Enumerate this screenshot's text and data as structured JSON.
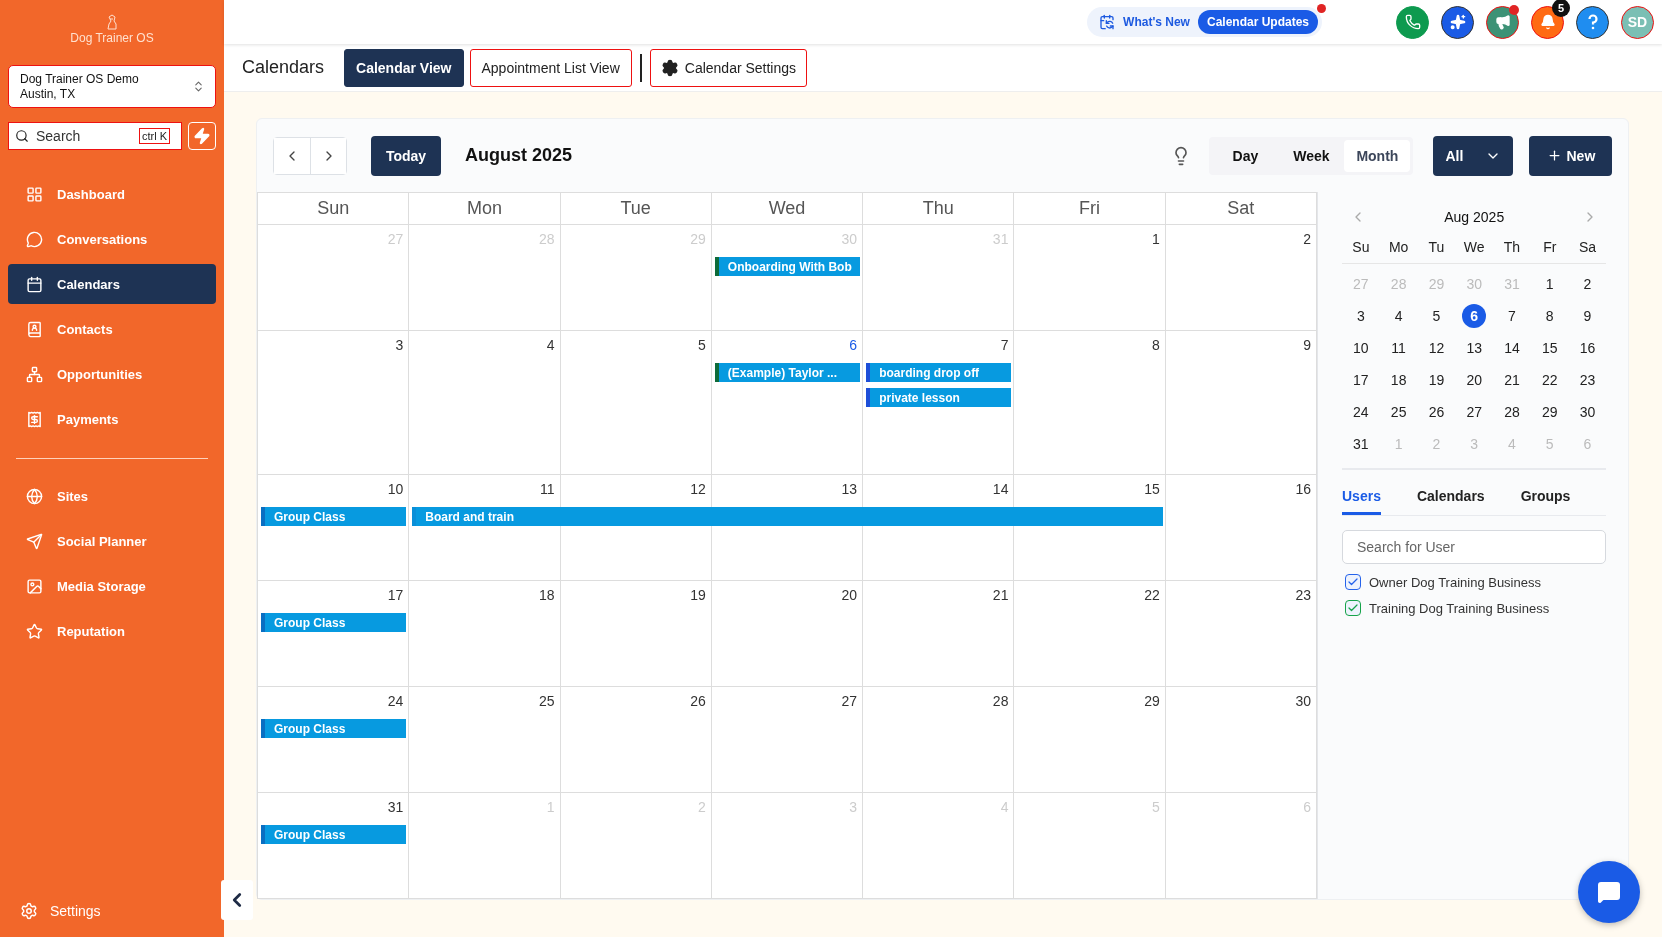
{
  "sidebar": {
    "brand": "Dog Trainer OS",
    "account": {
      "name": "Dog Trainer OS Demo",
      "location": "Austin, TX"
    },
    "search": {
      "placeholder": "Search",
      "shortcut": "ctrl K"
    },
    "items": [
      {
        "label": "Dashboard",
        "selected": false
      },
      {
        "label": "Conversations",
        "selected": false
      },
      {
        "label": "Calendars",
        "selected": true
      },
      {
        "label": "Contacts",
        "selected": false
      },
      {
        "label": "Opportunities",
        "selected": false
      },
      {
        "label": "Payments",
        "selected": false
      }
    ],
    "items_secondary": [
      {
        "label": "Sites",
        "selected": false
      },
      {
        "label": "Social Planner",
        "selected": false
      },
      {
        "label": "Media Storage",
        "selected": false
      },
      {
        "label": "Reputation",
        "selected": false
      }
    ],
    "settings": "Settings"
  },
  "topbar": {
    "whats_new": "What's New",
    "updates": "Calendar Updates",
    "notifications": "5",
    "avatar": "SD"
  },
  "header": {
    "title": "Calendars",
    "tabs": [
      {
        "label": "Calendar View",
        "selected": true
      },
      {
        "label": "Appointment List View",
        "selected": false
      }
    ],
    "settings": "Calendar Settings"
  },
  "toolbar": {
    "today": "Today",
    "month": "August 2025",
    "views": [
      {
        "label": "Day",
        "selected": false
      },
      {
        "label": "Week",
        "selected": false
      },
      {
        "label": "Month",
        "selected": true
      }
    ],
    "filter": "All",
    "new": "New"
  },
  "weekdays": [
    "Sun",
    "Mon",
    "Tue",
    "Wed",
    "Thu",
    "Fri",
    "Sat"
  ],
  "weeks": [
    {
      "days": [
        {
          "date": "27",
          "muted": true,
          "today": false
        },
        {
          "date": "28",
          "muted": true,
          "today": false
        },
        {
          "date": "29",
          "muted": true,
          "today": false
        },
        {
          "date": "30",
          "muted": true,
          "today": false,
          "events": [
            {
              "kind": "event",
              "title": "Onboarding With Bob",
              "color": "#0d6b3a"
            }
          ]
        },
        {
          "date": "31",
          "muted": true,
          "today": false
        },
        {
          "date": "1",
          "muted": false,
          "today": false
        },
        {
          "date": "2",
          "muted": false,
          "today": false
        }
      ]
    },
    {
      "days": [
        {
          "date": "3",
          "muted": false,
          "today": false
        },
        {
          "date": "4",
          "muted": false,
          "today": false
        },
        {
          "date": "5",
          "muted": false,
          "today": false
        },
        {
          "date": "6",
          "muted": false,
          "today": true,
          "events": [
            {
              "kind": "event",
              "title": "(Example) Taylor ...",
              "color": "#0d6b3a"
            }
          ]
        },
        {
          "date": "7",
          "muted": false,
          "today": false,
          "events": [
            {
              "kind": "event",
              "title": "boarding drop off",
              "color": "#1d4ed8"
            },
            {
              "kind": "event",
              "title": "private lesson",
              "color": "#1d4ed8"
            }
          ]
        },
        {
          "date": "8",
          "muted": false,
          "today": false
        },
        {
          "date": "9",
          "muted": false,
          "today": false
        }
      ]
    },
    {
      "days": [
        {
          "date": "10",
          "muted": false,
          "today": false,
          "events": [
            {
              "kind": "event",
              "title": "Group Class",
              "color": "#0a6fc2"
            }
          ]
        },
        {
          "date": "11",
          "muted": false,
          "today": false,
          "events": [
            {
              "kind": "event",
              "title": "Board and train",
              "color": "#0a8fd8"
            }
          ]
        },
        {
          "date": "12",
          "muted": false,
          "today": false,
          "events": [
            {
              "kind": "continuation"
            }
          ]
        },
        {
          "date": "13",
          "muted": false,
          "today": false,
          "events": [
            {
              "kind": "continuation"
            }
          ]
        },
        {
          "date": "14",
          "muted": false,
          "today": false,
          "events": [
            {
              "kind": "continuation"
            }
          ]
        },
        {
          "date": "15",
          "muted": false,
          "today": false,
          "events": [
            {
              "kind": "continuation"
            }
          ]
        },
        {
          "date": "16",
          "muted": false,
          "today": false
        }
      ]
    },
    {
      "days": [
        {
          "date": "17",
          "muted": false,
          "today": false,
          "events": [
            {
              "kind": "event",
              "title": "Group Class",
              "color": "#0a6fc2"
            }
          ]
        },
        {
          "date": "18",
          "muted": false,
          "today": false
        },
        {
          "date": "19",
          "muted": false,
          "today": false
        },
        {
          "date": "20",
          "muted": false,
          "today": false
        },
        {
          "date": "21",
          "muted": false,
          "today": false
        },
        {
          "date": "22",
          "muted": false,
          "today": false
        },
        {
          "date": "23",
          "muted": false,
          "today": false
        }
      ]
    },
    {
      "days": [
        {
          "date": "24",
          "muted": false,
          "today": false,
          "events": [
            {
              "kind": "event",
              "title": "Group Class",
              "color": "#0a6fc2"
            }
          ]
        },
        {
          "date": "25",
          "muted": false,
          "today": false
        },
        {
          "date": "26",
          "muted": false,
          "today": false
        },
        {
          "date": "27",
          "muted": false,
          "today": false
        },
        {
          "date": "28",
          "muted": false,
          "today": false
        },
        {
          "date": "29",
          "muted": false,
          "today": false
        },
        {
          "date": "30",
          "muted": false,
          "today": false
        }
      ]
    },
    {
      "days": [
        {
          "date": "31",
          "muted": false,
          "today": false,
          "events": [
            {
              "kind": "event",
              "title": "Group Class",
              "color": "#0a6fc2"
            }
          ]
        },
        {
          "date": "1",
          "muted": true,
          "today": false
        },
        {
          "date": "2",
          "muted": true,
          "today": false
        },
        {
          "date": "3",
          "muted": true,
          "today": false
        },
        {
          "date": "4",
          "muted": true,
          "today": false
        },
        {
          "date": "5",
          "muted": true,
          "today": false
        },
        {
          "date": "6",
          "muted": true,
          "today": false
        }
      ]
    }
  ],
  "mini_calendar": {
    "title": "Aug 2025",
    "weekdays": [
      "Su",
      "Mo",
      "Tu",
      "We",
      "Th",
      "Fr",
      "Sa"
    ],
    "weeks": [
      [
        {
          "date": "27",
          "muted": true,
          "selected": false
        },
        {
          "date": "28",
          "muted": true,
          "selected": false
        },
        {
          "date": "29",
          "muted": true,
          "selected": false
        },
        {
          "date": "30",
          "muted": true,
          "selected": false
        },
        {
          "date": "31",
          "muted": true,
          "selected": false
        },
        {
          "date": "1",
          "muted": false,
          "selected": false
        },
        {
          "date": "2",
          "muted": false,
          "selected": false
        }
      ],
      [
        {
          "date": "3",
          "muted": false,
          "selected": false
        },
        {
          "date": "4",
          "muted": false,
          "selected": false
        },
        {
          "date": "5",
          "muted": false,
          "selected": false
        },
        {
          "date": "6",
          "muted": false,
          "selected": true
        },
        {
          "date": "7",
          "muted": false,
          "selected": false
        },
        {
          "date": "8",
          "muted": false,
          "selected": false
        },
        {
          "date": "9",
          "muted": false,
          "selected": false
        }
      ],
      [
        {
          "date": "10",
          "muted": false,
          "selected": false
        },
        {
          "date": "11",
          "muted": false,
          "selected": false
        },
        {
          "date": "12",
          "muted": false,
          "selected": false
        },
        {
          "date": "13",
          "muted": false,
          "selected": false
        },
        {
          "date": "14",
          "muted": false,
          "selected": false
        },
        {
          "date": "15",
          "muted": false,
          "selected": false
        },
        {
          "date": "16",
          "muted": false,
          "selected": false
        }
      ],
      [
        {
          "date": "17",
          "muted": false,
          "selected": false
        },
        {
          "date": "18",
          "muted": false,
          "selected": false
        },
        {
          "date": "19",
          "muted": false,
          "selected": false
        },
        {
          "date": "20",
          "muted": false,
          "selected": false
        },
        {
          "date": "21",
          "muted": false,
          "selected": false
        },
        {
          "date": "22",
          "muted": false,
          "selected": false
        },
        {
          "date": "23",
          "muted": false,
          "selected": false
        }
      ],
      [
        {
          "date": "24",
          "muted": false,
          "selected": false
        },
        {
          "date": "25",
          "muted": false,
          "selected": false
        },
        {
          "date": "26",
          "muted": false,
          "selected": false
        },
        {
          "date": "27",
          "muted": false,
          "selected": false
        },
        {
          "date": "28",
          "muted": false,
          "selected": false
        },
        {
          "date": "29",
          "muted": false,
          "selected": false
        },
        {
          "date": "30",
          "muted": false,
          "selected": false
        }
      ],
      [
        {
          "date": "31",
          "muted": false,
          "selected": false
        },
        {
          "date": "1",
          "muted": true,
          "selected": false
        },
        {
          "date": "2",
          "muted": true,
          "selected": false
        },
        {
          "date": "3",
          "muted": true,
          "selected": false
        },
        {
          "date": "4",
          "muted": true,
          "selected": false
        },
        {
          "date": "5",
          "muted": true,
          "selected": false
        },
        {
          "date": "6",
          "muted": true,
          "selected": false
        }
      ]
    ]
  },
  "filter_tabs": [
    {
      "label": "Users",
      "selected": true
    },
    {
      "label": "Calendars",
      "selected": false
    },
    {
      "label": "Groups",
      "selected": false
    }
  ],
  "user_search": {
    "placeholder": "Search for User"
  },
  "users": [
    {
      "name": "Owner Dog Training Business",
      "checked": true,
      "color": "#2563eb"
    },
    {
      "name": "Training Dog Training Business",
      "checked": true,
      "color": "#16a34a"
    }
  ]
}
